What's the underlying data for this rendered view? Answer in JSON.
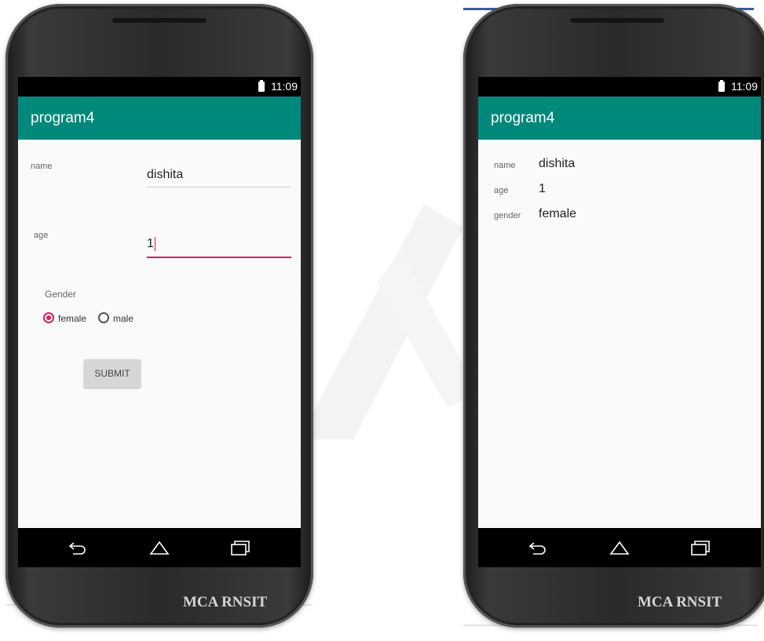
{
  "status_bar": {
    "time": "11:09"
  },
  "app": {
    "title": "program4"
  },
  "form": {
    "name_label": "name",
    "name_value": "dishita",
    "age_label": "age",
    "age_value": "1",
    "gender_label": "Gender",
    "gender_options": [
      {
        "label": "female",
        "checked": true
      },
      {
        "label": "male",
        "checked": false
      }
    ],
    "submit_label": "SUBMIT"
  },
  "result": {
    "rows": [
      {
        "label": "name",
        "value": "dishita"
      },
      {
        "label": "age",
        "value": "1"
      },
      {
        "label": "gender",
        "value": "female"
      }
    ]
  },
  "watermark": "MCA RNSIT",
  "colors": {
    "app_bar": "#00897b",
    "accent": "#d81b60",
    "status_bar": "#000000",
    "screen_background": "#fafafa"
  },
  "icons": [
    "battery-icon",
    "back-icon",
    "home-icon",
    "recents-icon"
  ]
}
